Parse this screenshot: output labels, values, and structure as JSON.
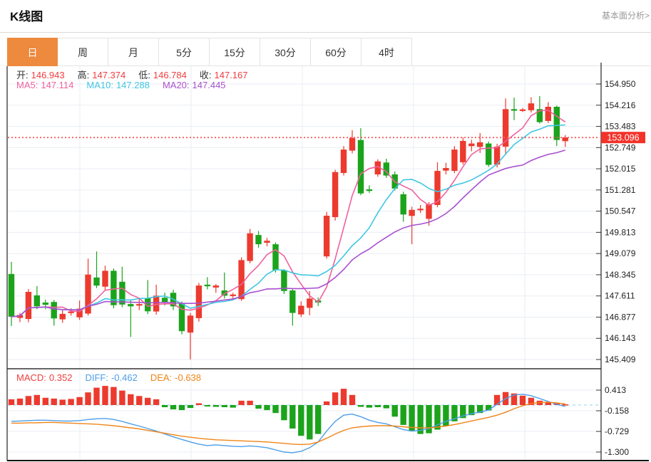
{
  "header": {
    "title": "K线图",
    "link": "基本面分析>"
  },
  "tabs": [
    {
      "name": "tab-day",
      "label": "日",
      "active": true
    },
    {
      "name": "tab-week",
      "label": "周",
      "active": false
    },
    {
      "name": "tab-month",
      "label": "月",
      "active": false
    },
    {
      "name": "tab-5min",
      "label": "5分",
      "active": false
    },
    {
      "name": "tab-15min",
      "label": "15分",
      "active": false
    },
    {
      "name": "tab-30min",
      "label": "30分",
      "active": false
    },
    {
      "name": "tab-60min",
      "label": "60分",
      "active": false
    },
    {
      "name": "tab-4hour",
      "label": "4时",
      "active": false
    }
  ],
  "legend_ohlc": [
    {
      "name": "open",
      "label": "开:",
      "value": "146.943"
    },
    {
      "name": "high",
      "label": "高:",
      "value": "147.374"
    },
    {
      "name": "low",
      "label": "低:",
      "value": "146.784"
    },
    {
      "name": "close",
      "label": "收:",
      "value": "147.167"
    }
  ],
  "legend_ma": [
    {
      "name": "ma5",
      "label": "MA5:",
      "value": "147.114",
      "color": "#f0609e"
    },
    {
      "name": "ma10",
      "label": "MA10:",
      "value": "147.288",
      "color": "#3fc6e4"
    },
    {
      "name": "ma20",
      "label": "MA20:",
      "value": "147.445",
      "color": "#a94fd0"
    }
  ],
  "legend_macd": [
    {
      "name": "macd",
      "label": "MACD:",
      "value": "0.352",
      "color": "#f03e3e"
    },
    {
      "name": "diff",
      "label": "DIFF:",
      "value": "-0.462",
      "color": "#4d9ee8"
    },
    {
      "name": "dea",
      "label": "DEA:",
      "value": "-0.638",
      "color": "#f08519"
    }
  ],
  "colors": {
    "up": "#ec3a2e",
    "down": "#1ca31c",
    "ma5": "#f0609e",
    "ma10": "#3fc6e4",
    "ma20": "#a94fd0",
    "diff": "#4d9ee8",
    "dea": "#f08519",
    "badge": "#f3322a",
    "dotted": "#f56060",
    "grid": "#e9eef4",
    "axis": "#333333",
    "zero_line": "#8fd4e8",
    "tab_active": "#ee8a3e"
  },
  "chart_data": {
    "type": "candlestick",
    "title": "K线图",
    "price_axis_labels": [
      "154.950",
      "154.216",
      "153.483",
      "152.749",
      "152.015",
      "151.281",
      "150.547",
      "149.813",
      "149.079",
      "148.345",
      "147.611",
      "146.877",
      "146.143",
      "145.409"
    ],
    "price_axis_range": [
      145.409,
      154.95
    ],
    "last_price": 153.096,
    "last_price_label": "153.096",
    "ma_periods": [
      5,
      10,
      20
    ],
    "candles": [
      [
        148.37,
        148.79,
        146.57,
        146.89
      ],
      [
        146.85,
        147.02,
        146.7,
        146.95
      ],
      [
        146.81,
        147.85,
        146.7,
        147.75
      ],
      [
        147.63,
        147.95,
        147.15,
        147.25
      ],
      [
        147.38,
        147.48,
        147.15,
        147.3
      ],
      [
        147.4,
        147.47,
        146.58,
        146.83
      ],
      [
        146.8,
        147.12,
        146.68,
        146.99
      ],
      [
        147.05,
        147.18,
        146.93,
        147.07
      ],
      [
        146.87,
        147.45,
        146.78,
        147.17
      ],
      [
        147.0,
        148.9,
        146.93,
        148.35
      ],
      [
        148.25,
        149.15,
        147.88,
        147.97
      ],
      [
        147.93,
        148.66,
        147.82,
        148.48
      ],
      [
        148.48,
        148.56,
        147.18,
        147.29
      ],
      [
        148.1,
        148.62,
        147.22,
        147.31
      ],
      [
        147.33,
        147.48,
        146.19,
        147.25
      ],
      [
        147.28,
        147.52,
        147.12,
        147.33
      ],
      [
        147.54,
        148.16,
        146.98,
        147.08
      ],
      [
        147.07,
        148.0,
        146.96,
        147.62
      ],
      [
        147.55,
        147.72,
        147.28,
        147.4
      ],
      [
        147.72,
        147.82,
        147.12,
        147.25
      ],
      [
        147.35,
        147.42,
        146.28,
        146.39
      ],
      [
        146.34,
        147.02,
        145.41,
        146.93
      ],
      [
        146.84,
        148.06,
        146.72,
        147.97
      ],
      [
        148.0,
        148.26,
        147.84,
        147.95
      ],
      [
        147.9,
        148.02,
        147.72,
        147.97
      ],
      [
        147.8,
        148.42,
        147.52,
        147.62
      ],
      [
        147.62,
        147.72,
        147.48,
        147.66
      ],
      [
        147.5,
        148.95,
        147.44,
        148.85
      ],
      [
        148.82,
        149.93,
        148.74,
        149.78
      ],
      [
        149.72,
        149.86,
        149.28,
        149.4
      ],
      [
        149.45,
        149.62,
        149.33,
        149.52
      ],
      [
        149.4,
        149.46,
        148.42,
        148.5
      ],
      [
        148.5,
        148.54,
        147.68,
        147.78
      ],
      [
        147.8,
        147.86,
        146.58,
        147.02
      ],
      [
        146.97,
        147.42,
        146.88,
        147.27
      ],
      [
        147.2,
        147.78,
        146.94,
        147.52
      ],
      [
        147.45,
        147.56,
        147.26,
        147.38
      ],
      [
        148.98,
        150.52,
        148.9,
        150.39
      ],
      [
        150.34,
        151.98,
        150.22,
        151.9
      ],
      [
        151.87,
        152.8,
        151.78,
        152.68
      ],
      [
        152.64,
        153.35,
        152.55,
        153.08
      ],
      [
        153.01,
        153.42,
        151.1,
        151.16
      ],
      [
        151.3,
        151.44,
        151.18,
        151.28
      ],
      [
        151.82,
        152.34,
        151.74,
        152.27
      ],
      [
        152.23,
        152.36,
        151.7,
        151.78
      ],
      [
        151.82,
        151.92,
        151.26,
        151.33
      ],
      [
        151.13,
        151.22,
        150.18,
        150.43
      ],
      [
        150.38,
        150.7,
        149.4,
        150.59
      ],
      [
        150.6,
        150.76,
        150.48,
        150.63
      ],
      [
        150.28,
        150.86,
        150.04,
        150.78
      ],
      [
        150.76,
        152.24,
        150.68,
        151.94
      ],
      [
        151.95,
        152.22,
        151.82,
        152.04
      ],
      [
        151.94,
        152.8,
        151.86,
        152.68
      ],
      [
        152.24,
        153.1,
        152.16,
        152.98
      ],
      [
        152.8,
        153.02,
        152.62,
        152.89
      ],
      [
        152.77,
        153.25,
        152.56,
        152.93
      ],
      [
        152.89,
        152.96,
        152.08,
        152.15
      ],
      [
        152.16,
        152.88,
        152.06,
        152.78
      ],
      [
        152.78,
        154.45,
        152.49,
        154.08
      ],
      [
        154.08,
        154.48,
        153.7,
        154.06
      ],
      [
        154.05,
        154.12,
        153.98,
        154.07
      ],
      [
        154.04,
        154.49,
        153.96,
        154.28
      ],
      [
        154.08,
        154.53,
        153.58,
        153.63
      ],
      [
        153.67,
        154.32,
        153.6,
        154.16
      ],
      [
        154.16,
        154.2,
        152.8,
        153.01
      ],
      [
        152.97,
        153.18,
        152.77,
        153.1
      ]
    ],
    "macd_axis_labels": [
      "0.413",
      "-0.158",
      "-0.729",
      "-1.300"
    ],
    "macd_hist": [
      0.16,
      0.18,
      0.25,
      0.28,
      0.2,
      0.18,
      0.15,
      0.17,
      0.22,
      0.35,
      0.48,
      0.53,
      0.5,
      0.4,
      0.3,
      0.25,
      0.2,
      0.16,
      -0.06,
      -0.12,
      -0.14,
      -0.08,
      0.05,
      -0.04,
      -0.05,
      -0.06,
      -0.07,
      0.12,
      0.12,
      -0.1,
      -0.14,
      -0.22,
      -0.42,
      -0.65,
      -0.85,
      -0.95,
      -0.8,
      0.1,
      0.35,
      0.45,
      0.28,
      -0.05,
      -0.07,
      -0.06,
      -0.09,
      -0.32,
      -0.55,
      -0.72,
      -0.8,
      -0.78,
      -0.68,
      -0.58,
      -0.45,
      -0.36,
      -0.28,
      -0.22,
      -0.15,
      0.28,
      0.36,
      0.32,
      0.26,
      0.2,
      0.12,
      0.08,
      0.05,
      0.02
    ],
    "macd_diff": [
      -0.45,
      -0.44,
      -0.43,
      -0.42,
      -0.42,
      -0.43,
      -0.44,
      -0.44,
      -0.43,
      -0.4,
      -0.38,
      -0.37,
      -0.4,
      -0.45,
      -0.52,
      -0.58,
      -0.65,
      -0.72,
      -0.8,
      -0.88,
      -0.95,
      -1.02,
      -1.08,
      -1.12,
      -1.1,
      -1.12,
      -1.14,
      -1.15,
      -1.13,
      -1.15,
      -1.18,
      -1.24,
      -1.3,
      -1.32,
      -1.28,
      -1.18,
      -1.02,
      -0.72,
      -0.45,
      -0.28,
      -0.25,
      -0.32,
      -0.42,
      -0.48,
      -0.52,
      -0.6,
      -0.68,
      -0.72,
      -0.7,
      -0.65,
      -0.55,
      -0.45,
      -0.38,
      -0.3,
      -0.24,
      -0.19,
      -0.14,
      0.02,
      0.18,
      0.28,
      0.3,
      0.26,
      0.18,
      0.1,
      0.02,
      -0.04
    ],
    "macd_dea": [
      -0.5,
      -0.5,
      -0.49,
      -0.49,
      -0.48,
      -0.48,
      -0.49,
      -0.5,
      -0.51,
      -0.52,
      -0.53,
      -0.55,
      -0.57,
      -0.6,
      -0.63,
      -0.66,
      -0.7,
      -0.74,
      -0.78,
      -0.82,
      -0.86,
      -0.89,
      -0.92,
      -0.94,
      -0.96,
      -0.97,
      -0.98,
      -0.99,
      -1.0,
      -1.01,
      -1.02,
      -1.04,
      -1.06,
      -1.08,
      -1.09,
      -1.08,
      -1.02,
      -0.92,
      -0.8,
      -0.7,
      -0.63,
      -0.6,
      -0.58,
      -0.57,
      -0.57,
      -0.58,
      -0.6,
      -0.62,
      -0.63,
      -0.63,
      -0.61,
      -0.58,
      -0.54,
      -0.49,
      -0.44,
      -0.39,
      -0.34,
      -0.28,
      -0.2,
      -0.1,
      -0.02,
      0.04,
      0.07,
      0.08,
      0.06,
      0.03
    ]
  }
}
